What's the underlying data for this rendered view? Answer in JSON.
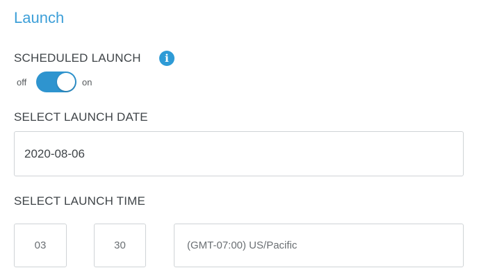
{
  "launch": {
    "title": "Launch",
    "scheduled_label": "SCHEDULED LAUNCH",
    "info_icon": "info-icon",
    "info_glyph": "i",
    "toggle": {
      "off_label": "off",
      "on_label": "on",
      "state": "on",
      "accent": "#2e94cf"
    },
    "date_label": "SELECT LAUNCH DATE",
    "date_value": "2020-08-06",
    "time_label": "SELECT LAUNCH TIME",
    "hour_value": "03",
    "minute_value": "30",
    "timezone_value": "(GMT-07:00) US/Pacific"
  },
  "colors": {
    "title": "#3d9fd8",
    "text": "#3f4448",
    "border": "#cfd3d6"
  }
}
